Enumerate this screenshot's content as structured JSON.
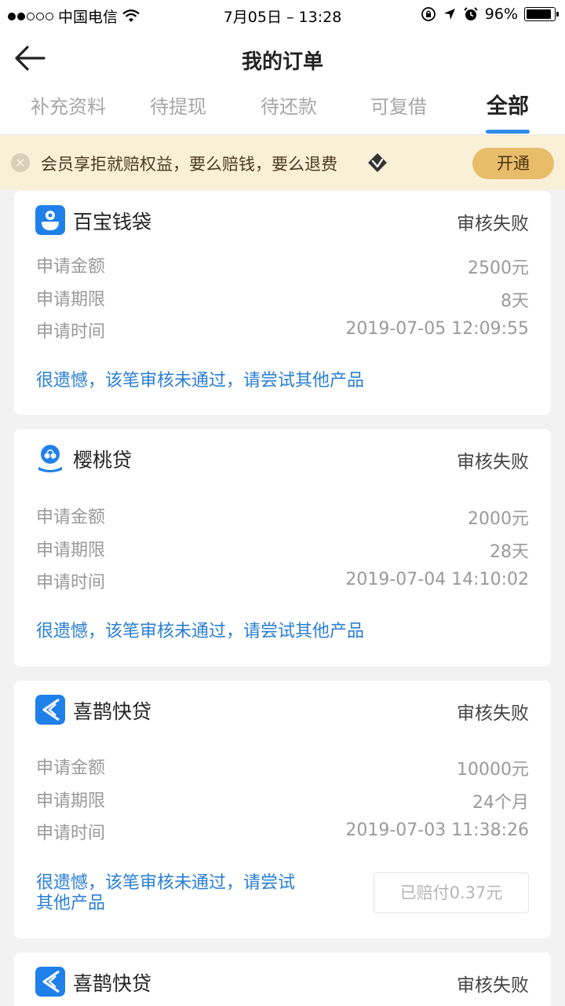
{
  "status_bar": {
    "carrier": "中国电信",
    "time": "7月05日 – 13:28",
    "battery": "96%"
  },
  "nav": {
    "title": "我的订单"
  },
  "tabs": [
    {
      "label": "补充资料"
    },
    {
      "label": "待提现"
    },
    {
      "label": "待还款"
    },
    {
      "label": "可复借"
    },
    {
      "label": "全部",
      "active": true
    }
  ],
  "banner": {
    "text": "会员享拒就赔权益，要么赔钱，要么退费",
    "button": "开通"
  },
  "labels": {
    "amount": "申请金额",
    "term": "申请期限",
    "time": "申请时间"
  },
  "orders": [
    {
      "name": "百宝钱袋",
      "logo": "wallet-robot-icon",
      "status": "审核失败",
      "amount": "2500元",
      "term": "8天",
      "time": "2019-07-05 12:09:55",
      "note": "很遗憾，该笔审核未通过，请尝试其他产品"
    },
    {
      "name": "樱桃贷",
      "logo": "cherry-icon",
      "status": "审核失败",
      "amount": "2000元",
      "term": "28天",
      "time": "2019-07-04 14:10:02",
      "note": "很遗憾，该笔审核未通过，请尝试其他产品"
    },
    {
      "name": "喜鹊快贷",
      "logo": "magpie-icon",
      "status": "审核失败",
      "amount": "10000元",
      "term": "24个月",
      "time": "2019-07-03 11:38:26",
      "note_line1": "很遗憾，该笔审核未通过，请尝试",
      "note_line2": "其他产品",
      "paid": "已赔付0.37元"
    },
    {
      "name": "喜鹊快贷",
      "logo": "magpie-icon",
      "status": "审核失败"
    }
  ],
  "colors": {
    "accent": "#2e8be8",
    "link": "#2a7fd4",
    "banner_bg": "#faf0d8",
    "vip_button": "#e8bd6a"
  }
}
